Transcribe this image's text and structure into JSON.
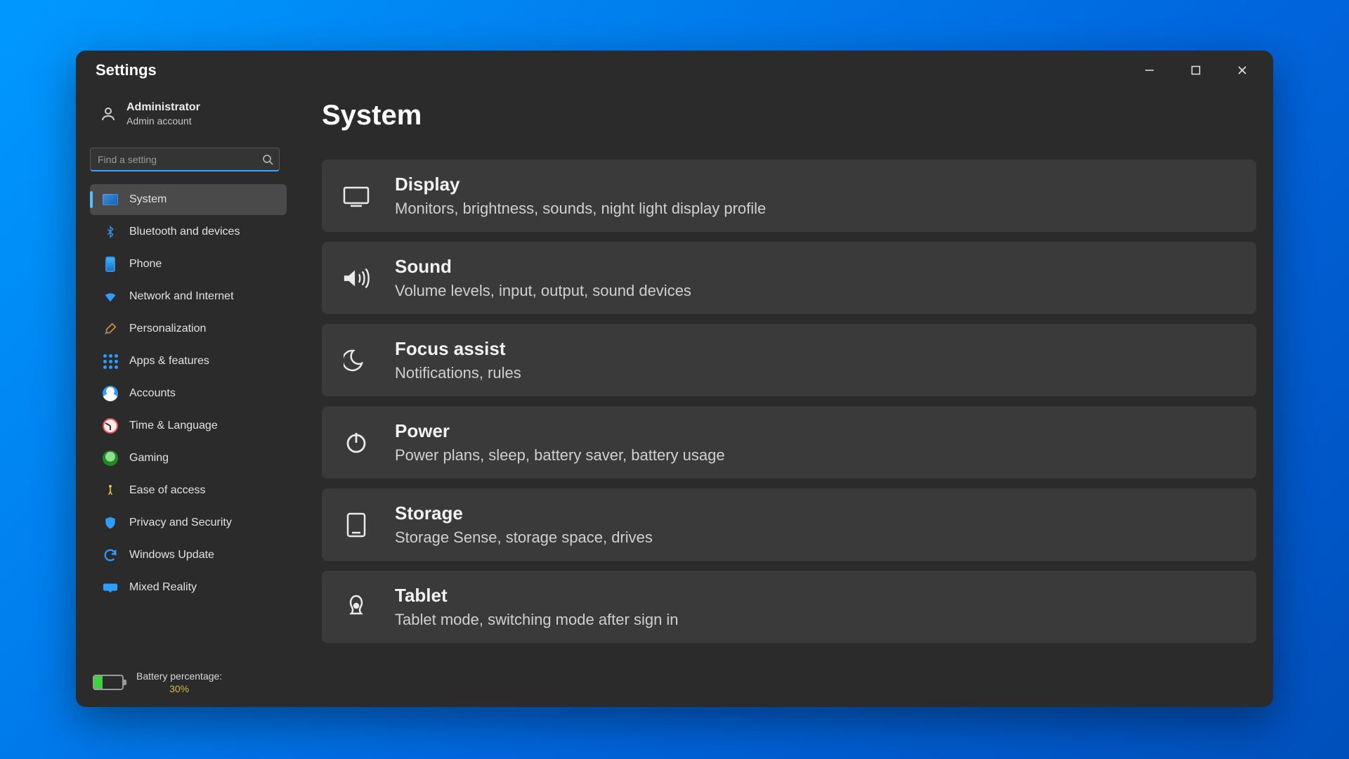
{
  "app": {
    "title": "Settings"
  },
  "window": {
    "minimize_tip": "Minimize",
    "maximize_tip": "Maximize",
    "close_tip": "Close"
  },
  "account": {
    "name": "Administrator",
    "subtitle": "Admin account"
  },
  "search": {
    "placeholder": "Find a setting"
  },
  "sidebar": {
    "items": [
      {
        "label": "System",
        "icon": "monitor-icon",
        "active": true
      },
      {
        "label": "Bluetooth and devices",
        "icon": "bluetooth-icon"
      },
      {
        "label": "Phone",
        "icon": "phone-icon"
      },
      {
        "label": "Network and Internet",
        "icon": "wifi-icon"
      },
      {
        "label": "Personalization",
        "icon": "brush-icon"
      },
      {
        "label": "Apps & features",
        "icon": "apps-grid-icon"
      },
      {
        "label": "Accounts",
        "icon": "account-icon"
      },
      {
        "label": "Time & Language",
        "icon": "clock-icon"
      },
      {
        "label": "Gaming",
        "icon": "xbox-icon"
      },
      {
        "label": "Ease of access",
        "icon": "accessibility-icon"
      },
      {
        "label": "Privacy and Security",
        "icon": "shield-icon"
      },
      {
        "label": "Windows Update",
        "icon": "update-icon"
      },
      {
        "label": "Mixed Reality",
        "icon": "mixed-reality-icon"
      }
    ]
  },
  "battery": {
    "label": "Battery percentage:",
    "percent": "30%",
    "pct_num": 30
  },
  "page": {
    "title": "System"
  },
  "cards": [
    {
      "title": "Display",
      "subtitle": "Monitors, brightness, sounds, night light display profile",
      "icon": "display-icon"
    },
    {
      "title": "Sound",
      "subtitle": "Volume levels, input, output, sound devices",
      "icon": "sound-icon"
    },
    {
      "title": "Focus assist",
      "subtitle": "Notifications, rules",
      "icon": "moon-icon"
    },
    {
      "title": "Power",
      "subtitle": "Power plans, sleep, battery saver, battery usage",
      "icon": "power-icon"
    },
    {
      "title": "Storage",
      "subtitle": "Storage Sense, storage space, drives",
      "icon": "storage-icon"
    },
    {
      "title": "Tablet",
      "subtitle": "Tablet mode, switching mode after sign in",
      "icon": "tablet-icon"
    }
  ]
}
